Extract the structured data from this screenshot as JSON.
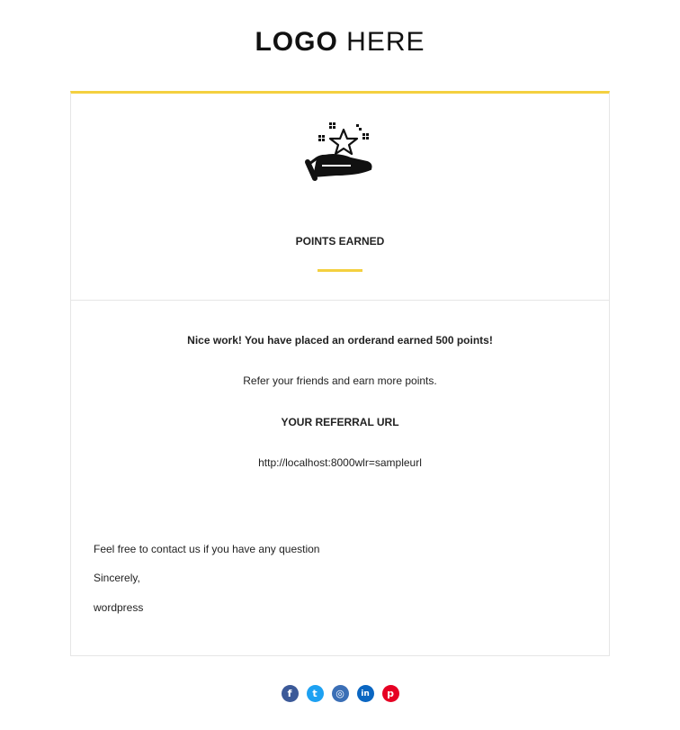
{
  "header": {
    "logo_bold": "LOGO",
    "logo_light": "HERE"
  },
  "colors": {
    "accent": "#f4d03f",
    "facebook": "#3b5998",
    "twitter": "#1da1f2",
    "instagram": "#3b6fb6",
    "linkedin": "#0a66c2",
    "pinterest": "#e60023"
  },
  "card": {
    "icon": "hand-star-icon",
    "title": "POINTS EARNED",
    "message": "Nice work! You have placed an orderand earned 500 points!",
    "refer_text": "Refer your friends and earn more points.",
    "referral_heading": "YOUR REFERRAL URL",
    "referral_url": "http://localhost:8000wlr=sampleurl",
    "contact_text": "Feel free to contact us if you have any question",
    "closing": "Sincerely,",
    "signature": "wordpress"
  },
  "social": [
    {
      "name": "facebook-icon",
      "glyph": "f"
    },
    {
      "name": "twitter-icon",
      "glyph": "t"
    },
    {
      "name": "instagram-icon",
      "glyph": "◎"
    },
    {
      "name": "linkedin-icon",
      "glyph": "in"
    },
    {
      "name": "pinterest-icon",
      "glyph": "p"
    }
  ]
}
